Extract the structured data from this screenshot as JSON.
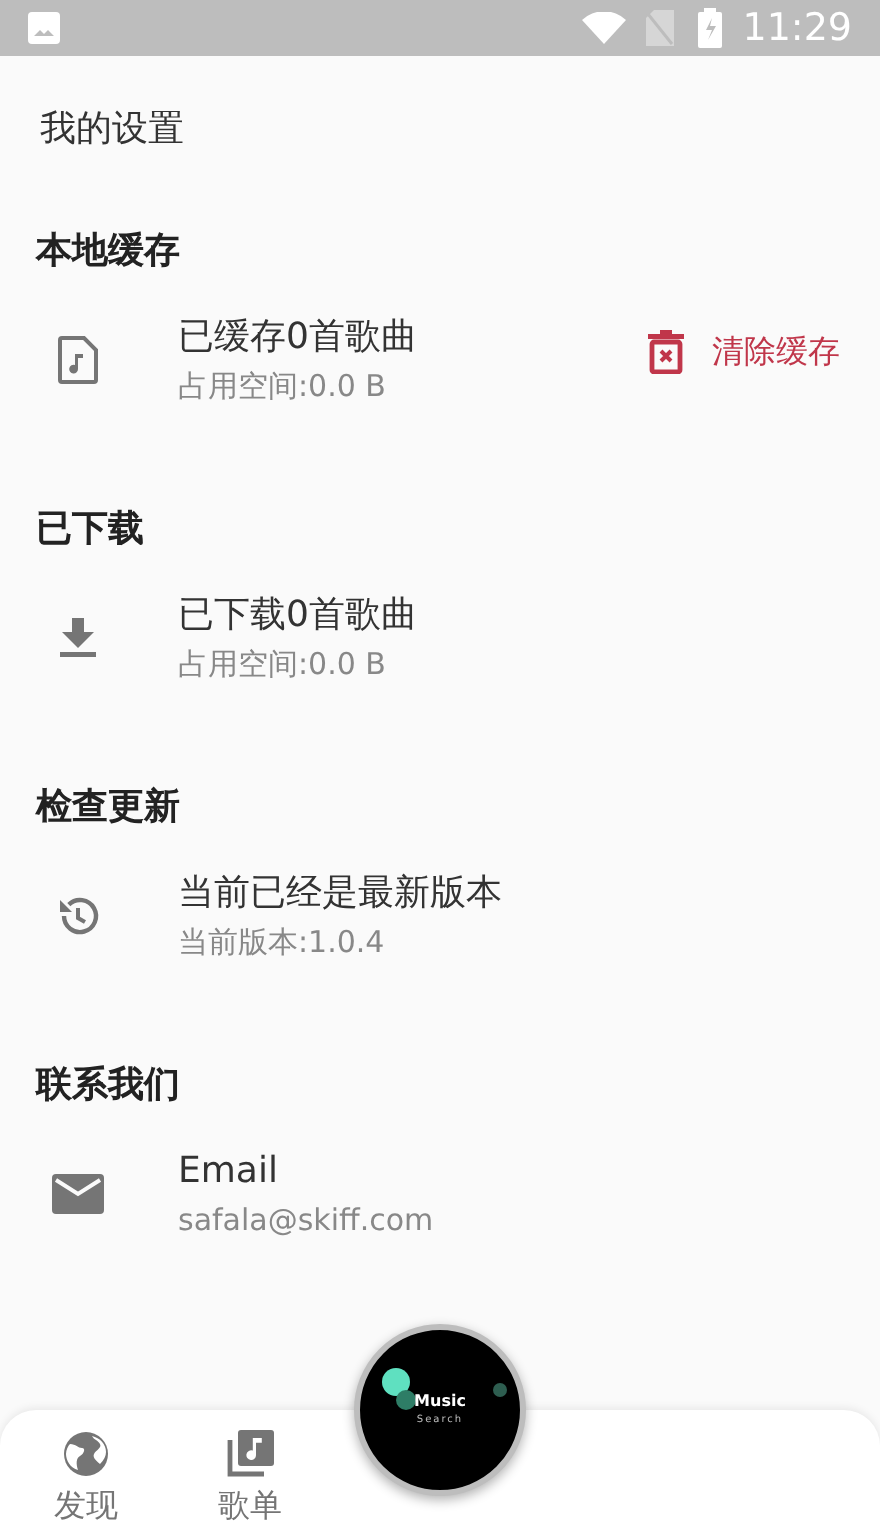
{
  "status_bar": {
    "time": "11:29"
  },
  "header": {
    "title": "我的设置"
  },
  "sections": [
    {
      "title": "本地缓存",
      "item": {
        "kind": "cache",
        "title": "已缓存0首歌曲",
        "subtitle": "占用空间:0.0 B",
        "action": "清除缓存"
      }
    },
    {
      "title": "已下载",
      "item": {
        "kind": "download",
        "title": "已下载0首歌曲",
        "subtitle": "占用空间:0.0 B"
      }
    },
    {
      "title": "检查更新",
      "item": {
        "kind": "update",
        "title": "当前已经是最新版本",
        "subtitle": "当前版本:1.0.4"
      }
    },
    {
      "title": "联系我们",
      "item": {
        "kind": "email",
        "title": "Email",
        "subtitle": "safala@skiff.com"
      }
    }
  ],
  "bottom_nav": {
    "items": [
      {
        "kind": "globe",
        "label": "发现"
      },
      {
        "kind": "playlist",
        "label": "歌单"
      }
    ],
    "center": {
      "title": "Music",
      "subtitle": "Search"
    }
  }
}
